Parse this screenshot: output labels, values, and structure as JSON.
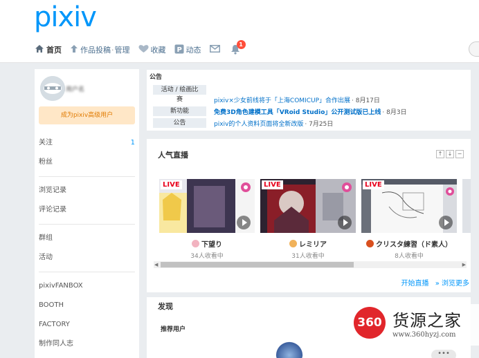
{
  "logo": "pixiv",
  "nav": {
    "home": "首页",
    "works": "作品投稿",
    "manage": "管理",
    "bookmarks": "收藏",
    "feed": "动态",
    "notif_count": "1"
  },
  "sidebar": {
    "username": "用户名",
    "premium_label": "成为pixiv高级用户",
    "items_a": [
      {
        "label": "关注",
        "count": "1"
      },
      {
        "label": "粉丝",
        "count": ""
      }
    ],
    "items_b": [
      {
        "label": "浏览记录"
      },
      {
        "label": "评论记录"
      }
    ],
    "items_c": [
      {
        "label": "群组"
      },
      {
        "label": "活动"
      }
    ],
    "items_d": [
      {
        "label": "pixivFANBOX"
      },
      {
        "label": "BOOTH"
      },
      {
        "label": "FACTORY"
      },
      {
        "label": "制作同人志"
      }
    ]
  },
  "announce": {
    "title": "公告",
    "rows": [
      {
        "tag": "活动 / 绘画比",
        "text": "",
        "date": ""
      },
      {
        "tag": "赛",
        "text": "pixiv×少女前线将于「上海COMICUP」合作出展",
        "date": "· 8月17日"
      },
      {
        "tag": "新功能",
        "text": "免费3D角色建模工具「VRoid Studio」公开测试版已上线",
        "date": "· 8月3日"
      },
      {
        "tag": "公告",
        "text": "pixiv的个人资料页面将全新改版",
        "date": "· 7月25日"
      }
    ]
  },
  "live": {
    "title": "人气直播",
    "live_tag": "LIVE",
    "cards": [
      {
        "name": "下望り",
        "viewers": "34人收看中",
        "color": "#f2b3c0"
      },
      {
        "name": "レミリア",
        "viewers": "31人收看中",
        "color": "#f1b25a"
      },
      {
        "name": "クリスタ練習（ド素人）",
        "viewers": "8人收看中",
        "color": "#d9501f"
      }
    ],
    "start_link": "开始直播",
    "browse_link": "» 浏览更多"
  },
  "discover": {
    "title": "发现",
    "subtitle": "推荐用户",
    "more": "•••"
  },
  "watermark": {
    "badge": "360",
    "name": "货源之家",
    "url": "www.360hyzj.com"
  }
}
